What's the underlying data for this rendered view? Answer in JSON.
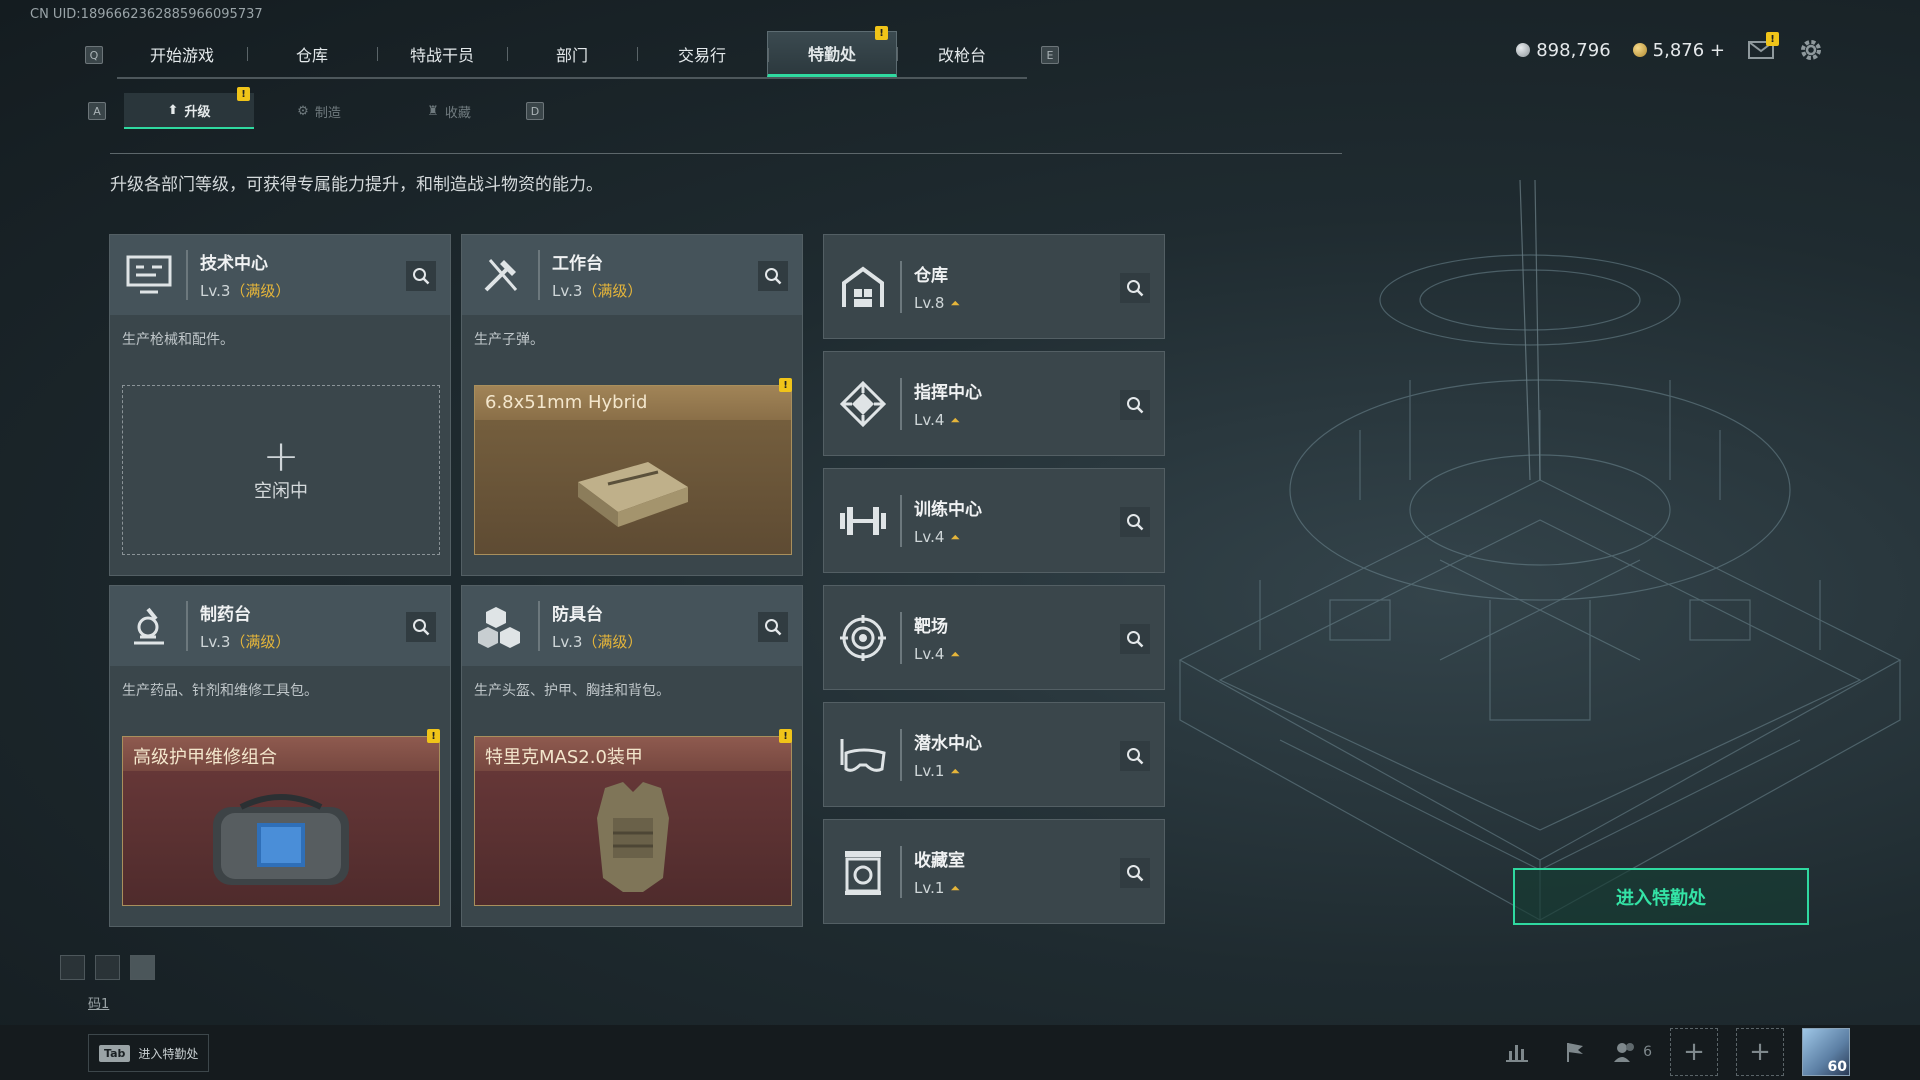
{
  "uid": "CN UID:1896662362885966095737",
  "topnav": {
    "left_key": "Q",
    "right_key": "E",
    "tabs": [
      {
        "label": "开始游戏"
      },
      {
        "label": "仓库"
      },
      {
        "label": "特战干员"
      },
      {
        "label": "部门"
      },
      {
        "label": "交易行"
      },
      {
        "label": "特勤处",
        "active": true,
        "badge": "!"
      },
      {
        "label": "改枪台"
      }
    ]
  },
  "currency": {
    "silver": "898,796",
    "gold": "5,876 +"
  },
  "mail_badge": "!",
  "subnav": {
    "left_key": "A",
    "right_key": "D",
    "tabs": [
      {
        "label": "升级",
        "active": true,
        "badge": "!"
      },
      {
        "label": "制造"
      },
      {
        "label": "收藏"
      }
    ]
  },
  "description": "升级各部门等级，可获得专属能力提升，和制造战斗物资的能力。",
  "workshops": [
    {
      "name": "技术中心",
      "level": "Lv.3",
      "max": "（满级）",
      "sub": "生产枪械和配件。",
      "slot": {
        "state": "empty",
        "label": "空闲中"
      }
    },
    {
      "name": "工作台",
      "level": "Lv.3",
      "max": "（满级）",
      "sub": "生产子弹。",
      "slot": {
        "state": "item",
        "title": "6.8x51mm Hybrid",
        "badge": "!"
      }
    },
    {
      "name": "制药台",
      "level": "Lv.3",
      "max": "（满级）",
      "sub": "生产药品、针剂和维修工具包。",
      "slot": {
        "state": "item",
        "title": "高级护甲维修组合",
        "badge": "!"
      }
    },
    {
      "name": "防具台",
      "level": "Lv.3",
      "max": "（满级）",
      "sub": "生产头盔、护甲、胸挂和背包。",
      "slot": {
        "state": "item",
        "title": "特里克MAS2.0装甲",
        "badge": "!"
      }
    }
  ],
  "departments": [
    {
      "name": "仓库",
      "level": "Lv.8",
      "icon": "warehouse-icon"
    },
    {
      "name": "指挥中心",
      "level": "Lv.4",
      "icon": "command-center-icon"
    },
    {
      "name": "训练中心",
      "level": "Lv.4",
      "icon": "dumbbell-icon"
    },
    {
      "name": "靶场",
      "level": "Lv.4",
      "icon": "target-icon"
    },
    {
      "name": "潜水中心",
      "level": "Lv.1",
      "icon": "diving-mask-icon"
    },
    {
      "name": "收藏室",
      "level": "Lv.1",
      "icon": "collection-icon"
    }
  ],
  "enter_button": "进入特勤处",
  "code_label": "码1",
  "bottom": {
    "tab_key": "Tab",
    "tab_hint": "进入特勤处",
    "friends_count": "6",
    "avatar_level": "60"
  },
  "colors": {
    "accent": "#2fd9a0",
    "max_level": "#e5b53a",
    "badge": "#f0c419"
  }
}
